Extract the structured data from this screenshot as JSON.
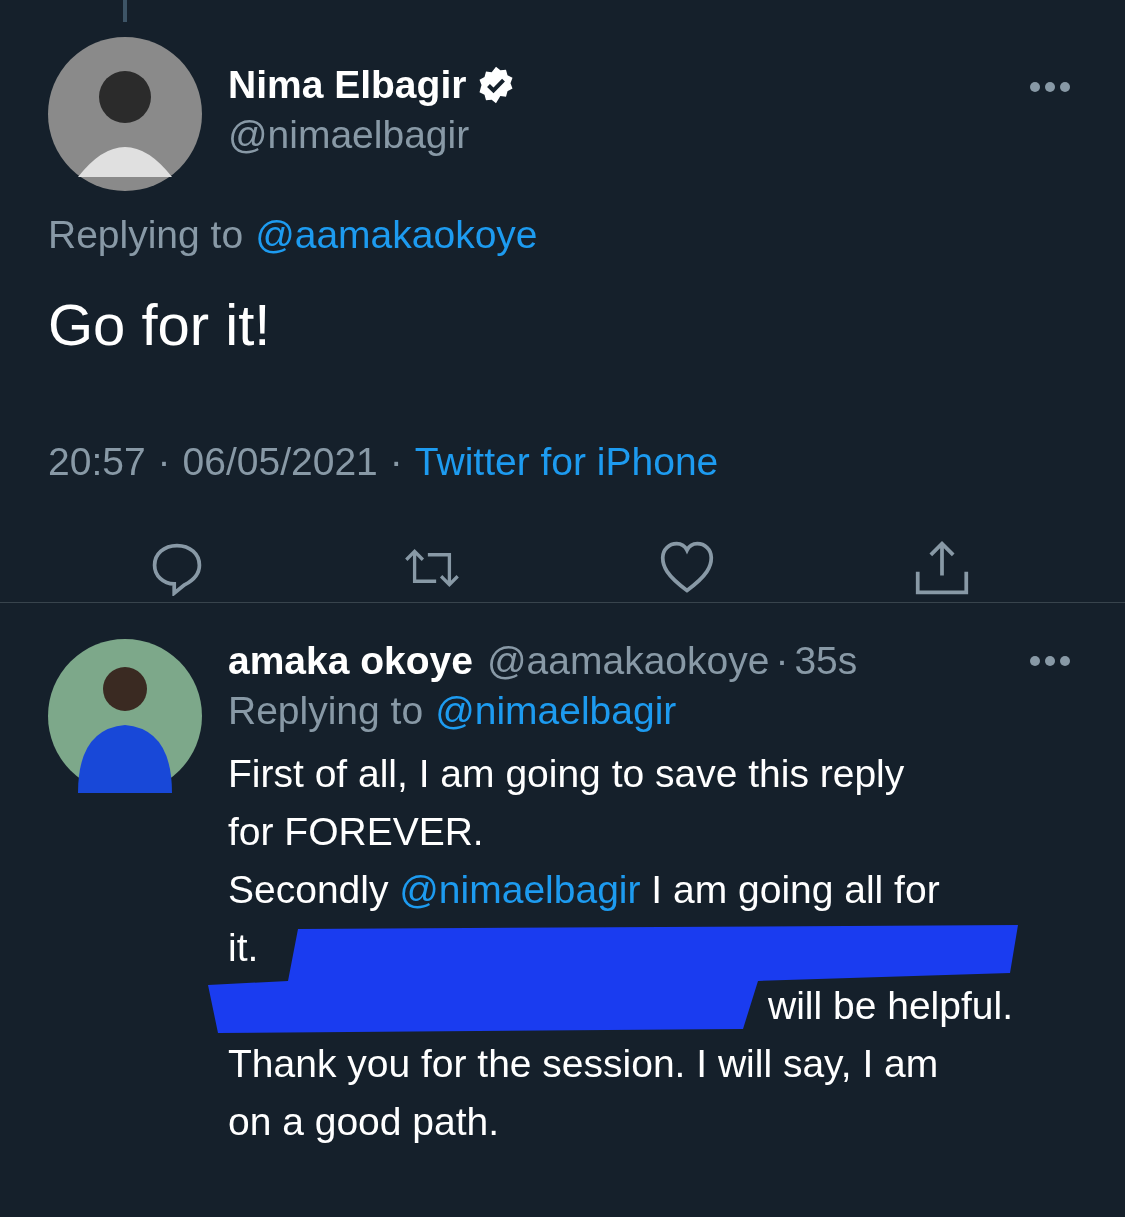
{
  "tweet": {
    "name": "Nima Elbagir",
    "verified": true,
    "handle": "@nimaelbagir",
    "replying_label": "Replying to",
    "replying_to": "@aamakaokoye",
    "text": "Go for it!",
    "time": "20:57",
    "separator_1": "·",
    "date": "06/05/2021",
    "separator_2": "·",
    "source": "Twitter for iPhone",
    "actions": [
      {
        "kind": "reply"
      },
      {
        "kind": "retweet"
      },
      {
        "kind": "like"
      },
      {
        "kind": "share"
      }
    ]
  },
  "reply": {
    "name": "amaka okoye",
    "handle": "@aamakaokoye",
    "separator": "·",
    "age": "35s",
    "replying_label": "Replying to",
    "replying_to": "@nimaelbagir",
    "lines": [
      [
        {
          "kind": "text",
          "text": "First of all, I am going to save this reply"
        }
      ],
      [
        {
          "kind": "text",
          "text": "for FOREVER."
        }
      ],
      [
        {
          "kind": "text",
          "text": "Secondly "
        },
        {
          "kind": "mention",
          "text": "@nimaelbagir"
        },
        {
          "kind": "text",
          "text": " I am going all for"
        }
      ],
      [
        {
          "kind": "text",
          "text": "it."
        }
      ],
      [
        {
          "kind": "hidden"
        },
        {
          "kind": "text",
          "text": "will be helpful."
        }
      ],
      [
        {
          "kind": "text",
          "text": "Thank you for the session. I will say, I am"
        }
      ],
      [
        {
          "kind": "text",
          "text": "on a good path."
        }
      ]
    ],
    "redacted": true
  }
}
